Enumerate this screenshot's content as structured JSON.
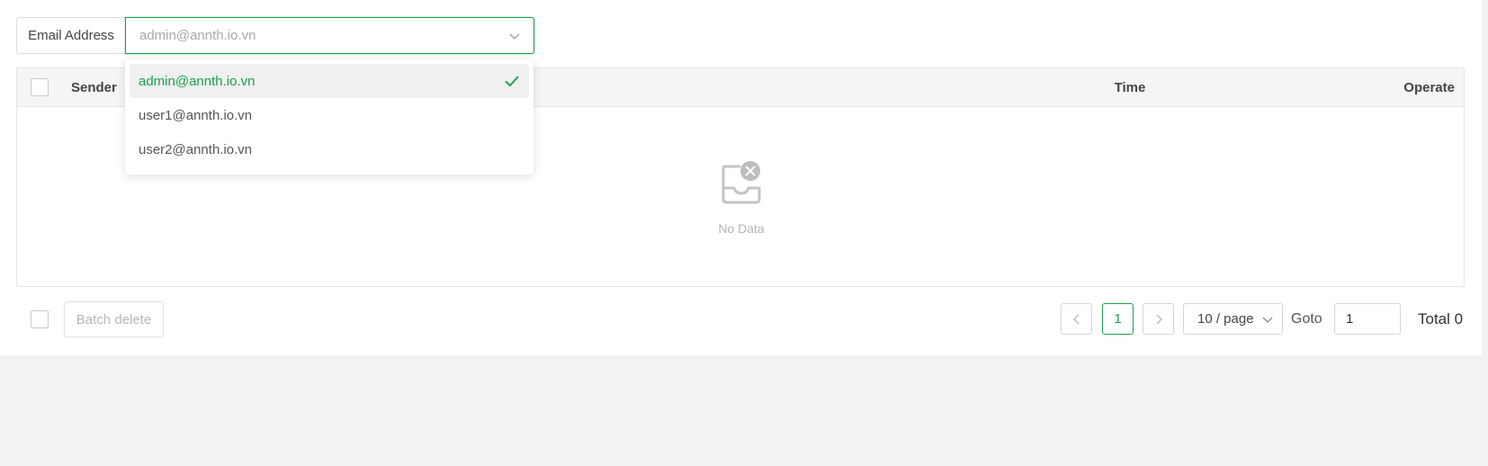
{
  "filter": {
    "label": "Email Address",
    "placeholder": "admin@annth.io.vn"
  },
  "dropdown": {
    "options": [
      {
        "label": "admin@annth.io.vn",
        "selected": true
      },
      {
        "label": "user1@annth.io.vn",
        "selected": false
      },
      {
        "label": "user2@annth.io.vn",
        "selected": false
      }
    ]
  },
  "table": {
    "columns": {
      "sender": "Sender",
      "time": "Time",
      "operate": "Operate"
    },
    "empty_text": "No Data"
  },
  "footer": {
    "batch_delete": "Batch delete",
    "current_page": "1",
    "page_size": "10 / page",
    "goto_label": "Goto",
    "goto_value": "1",
    "total": "Total 0"
  },
  "colors": {
    "accent": "#16a34a",
    "background": "#f2f2f2"
  },
  "icons": [
    "chevron-down-icon",
    "check-icon",
    "empty-inbox-icon",
    "chevron-left-icon",
    "chevron-right-icon"
  ]
}
